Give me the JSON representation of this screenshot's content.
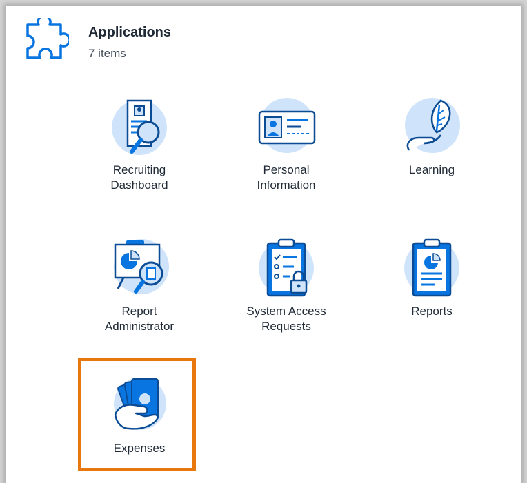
{
  "header": {
    "icon": "puzzle-piece-icon",
    "title": "Applications",
    "count": "7 items"
  },
  "apps": [
    {
      "label": "Recruiting\nDashboard",
      "icon": "resume-magnifier-icon"
    },
    {
      "label": "Personal\nInformation",
      "icon": "id-card-icon"
    },
    {
      "label": "Learning",
      "icon": "hand-leaf-icon"
    },
    {
      "label": "Report\nAdministrator",
      "icon": "chart-board-magnifier-icon"
    },
    {
      "label": "System Access\nRequests",
      "icon": "clipboard-lock-icon"
    },
    {
      "label": "Reports",
      "icon": "clipboard-chart-icon"
    },
    {
      "label": "Expenses",
      "icon": "hand-cash-icon"
    }
  ],
  "colors": {
    "accent_blue": "#0875e1",
    "icon_light_blue": "#cfe4fb",
    "highlight_orange": "#e8780d"
  }
}
